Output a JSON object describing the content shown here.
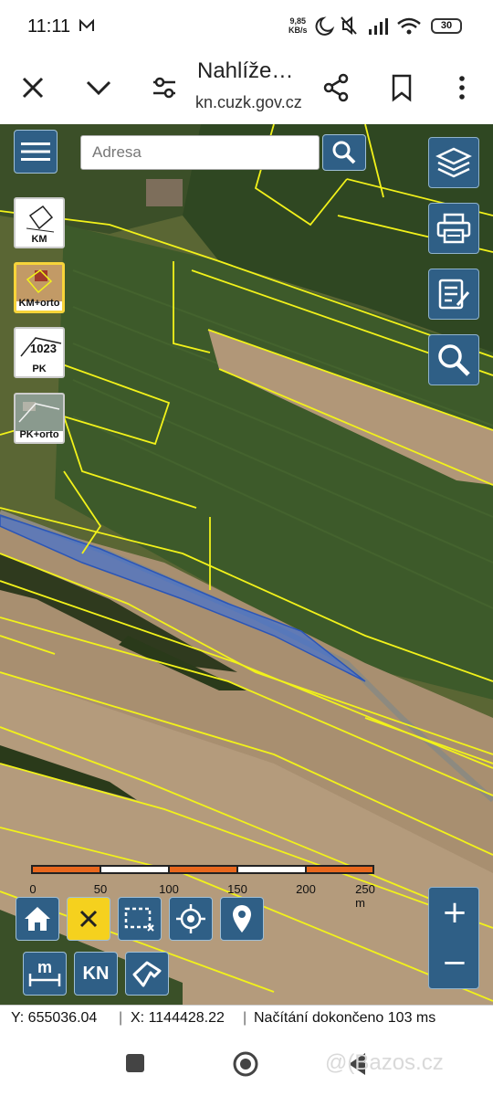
{
  "status_bar": {
    "time": "11:11",
    "speed_value": "9,85",
    "speed_unit": "KB/s",
    "battery": "30"
  },
  "browser": {
    "page_title": "Nahlíže…",
    "page_url": "kn.cuzk.gov.cz"
  },
  "map": {
    "search_placeholder": "Adresa",
    "layers": [
      {
        "label": "KM",
        "active": false
      },
      {
        "label": "KM+orto",
        "active": true
      },
      {
        "label": "PK",
        "active": false
      },
      {
        "label": "PK+orto",
        "active": false
      }
    ],
    "scale_labels": [
      "0",
      "50",
      "100",
      "150",
      "200",
      "250 m"
    ],
    "zoom_in_label": "+",
    "zoom_out_label": "−",
    "kn_label": "KN",
    "colors": {
      "button_bg": "#2f5f86",
      "parcel_lines": "#f2f21a",
      "highlight_parcel": "#3a6fd8",
      "scale_orange": "#e8671d",
      "clear_button": "#f5d11e"
    }
  },
  "coords": {
    "y_text": "Y: 655036.04",
    "x_text": "X: 1144428.22",
    "status_text": "Načítání dokončeno 103 ms"
  },
  "watermark": "@(Bazos.cz"
}
